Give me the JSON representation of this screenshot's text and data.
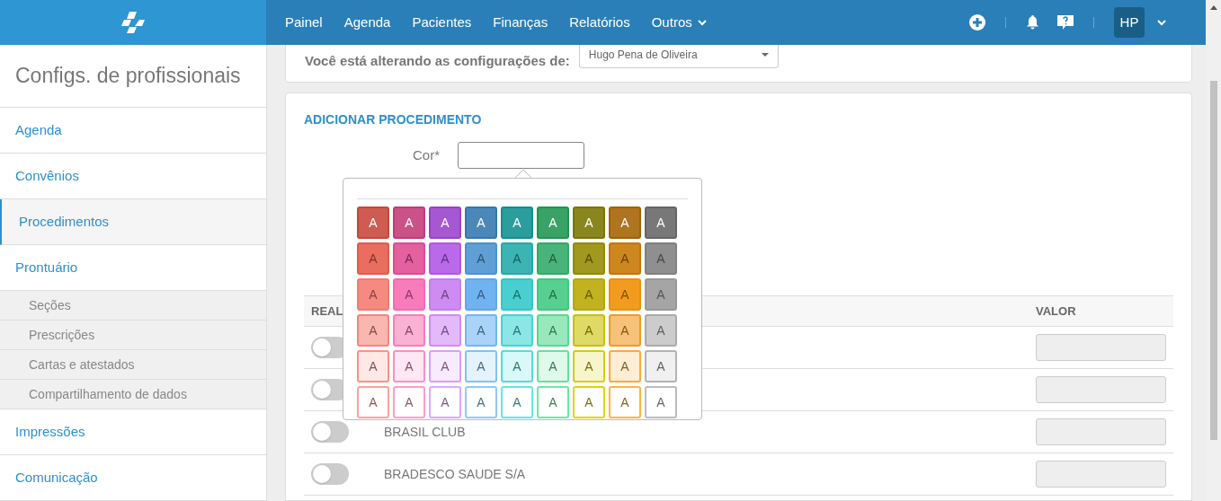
{
  "header": {
    "nav": [
      {
        "label": "Painel",
        "dropdown": false
      },
      {
        "label": "Agenda",
        "dropdown": false
      },
      {
        "label": "Pacientes",
        "dropdown": false
      },
      {
        "label": "Finanças",
        "dropdown": false
      },
      {
        "label": "Relatórios",
        "dropdown": false
      },
      {
        "label": "Outros",
        "dropdown": true
      }
    ],
    "avatar": "HP"
  },
  "sidebar": {
    "title": "Configs. de profissionais",
    "items": [
      {
        "label": "Agenda",
        "kind": "item",
        "selected": false
      },
      {
        "label": "Convênios",
        "kind": "item",
        "selected": false
      },
      {
        "label": "Procedimentos",
        "kind": "item",
        "selected": true
      },
      {
        "label": "Prontuário",
        "kind": "item",
        "selected": false
      },
      {
        "label": "Seções",
        "kind": "subitem",
        "selected": false
      },
      {
        "label": "Prescrições",
        "kind": "subitem",
        "selected": false
      },
      {
        "label": "Cartas e atestados",
        "kind": "subitem",
        "selected": false
      },
      {
        "label": "Compartilhamento de dados",
        "kind": "subitem",
        "selected": false
      },
      {
        "label": "Impressões",
        "kind": "item",
        "selected": false
      },
      {
        "label": "Comunicação",
        "kind": "item",
        "selected": false
      }
    ]
  },
  "professional": {
    "label": "Você está alterando as configurações de:",
    "value": "Hugo Pena de Oliveira"
  },
  "form": {
    "title": "ADICIONAR PROCEDIMENTO",
    "color_label": "Cor*"
  },
  "color_picker": {
    "rows": [
      {
        "kind": "solid",
        "swatches": [
          {
            "label": "A",
            "color": "#c9463b"
          },
          {
            "label": "A",
            "color": "#c33a78"
          },
          {
            "label": "A",
            "color": "#9a40cc"
          },
          {
            "label": "A",
            "color": "#3378b0"
          },
          {
            "label": "A",
            "color": "#0e9090"
          },
          {
            "label": "A",
            "color": "#1e9552"
          },
          {
            "label": "A",
            "color": "#7a7500"
          },
          {
            "label": "A",
            "color": "#a36100"
          },
          {
            "label": "A",
            "color": "#666666"
          }
        ]
      },
      {
        "kind": "bright",
        "swatches": [
          {
            "label": "A",
            "color": "#e65a4a"
          },
          {
            "label": "A",
            "color": "#e04a92"
          },
          {
            "label": "A",
            "color": "#b155e6"
          },
          {
            "label": "A",
            "color": "#4a92cf"
          },
          {
            "label": "A",
            "color": "#22aaaa"
          },
          {
            "label": "A",
            "color": "#30aa68"
          },
          {
            "label": "A",
            "color": "#938a00"
          },
          {
            "label": "A",
            "color": "#c77500"
          },
          {
            "label": "A",
            "color": "#808080"
          }
        ]
      },
      {
        "kind": "soft",
        "swatches": [
          {
            "label": "A",
            "color": "#f57a70"
          },
          {
            "label": "A",
            "color": "#f76aaf"
          },
          {
            "label": "A",
            "color": "#c77cf0"
          },
          {
            "label": "A",
            "color": "#5ea8ee"
          },
          {
            "label": "A",
            "color": "#30c8c8"
          },
          {
            "label": "A",
            "color": "#40c880"
          },
          {
            "label": "A",
            "color": "#b8a900"
          },
          {
            "label": "A",
            "color": "#f08f00"
          },
          {
            "label": "A",
            "color": "#999999"
          }
        ]
      },
      {
        "kind": "light",
        "swatches": [
          {
            "label": "A",
            "color": "#f7857b"
          },
          {
            "label": "A",
            "color": "#f87db8"
          },
          {
            "label": "A",
            "color": "#d08af5"
          },
          {
            "label": "A",
            "color": "#72b6f2"
          },
          {
            "label": "A",
            "color": "#3ed6d6"
          },
          {
            "label": "A",
            "color": "#55d890"
          },
          {
            "label": "A",
            "color": "#c9c000"
          },
          {
            "label": "A",
            "color": "#f09a20"
          },
          {
            "label": "A",
            "color": "#aaaaaa"
          }
        ]
      },
      {
        "kind": "pale",
        "swatches": [
          {
            "label": "A",
            "color": "#ff8f85"
          },
          {
            "label": "A",
            "color": "#ff8cc4"
          },
          {
            "label": "A",
            "color": "#dd9bfb"
          },
          {
            "label": "A",
            "color": "#7ec2fb"
          },
          {
            "label": "A",
            "color": "#4ddddd"
          },
          {
            "label": "A",
            "color": "#5ee39b"
          },
          {
            "label": "A",
            "color": "#d8cc00"
          },
          {
            "label": "A",
            "color": "#ffa733"
          },
          {
            "label": "A",
            "color": "#b3b3b3"
          }
        ]
      },
      {
        "kind": "outline",
        "swatches": [
          {
            "label": "A",
            "color": "#ffa09a"
          },
          {
            "label": "A",
            "color": "#ff9ccc"
          },
          {
            "label": "A",
            "color": "#e0a6fc"
          },
          {
            "label": "A",
            "color": "#8bc9fc"
          },
          {
            "label": "A",
            "color": "#5ee8e8"
          },
          {
            "label": "A",
            "color": "#6be8a5"
          },
          {
            "label": "A",
            "color": "#e2d400"
          },
          {
            "label": "A",
            "color": "#ffb340"
          },
          {
            "label": "A",
            "color": "#bbbbbb"
          }
        ]
      }
    ]
  },
  "table": {
    "columns": [
      "REAL",
      "VALOR"
    ],
    "rows": [
      {
        "on": false
      },
      {
        "on": false
      },
      {
        "on": false,
        "name": "BRASIL CLUB"
      },
      {
        "on": false,
        "name": "BRADESCO SAUDE S/A"
      }
    ]
  }
}
